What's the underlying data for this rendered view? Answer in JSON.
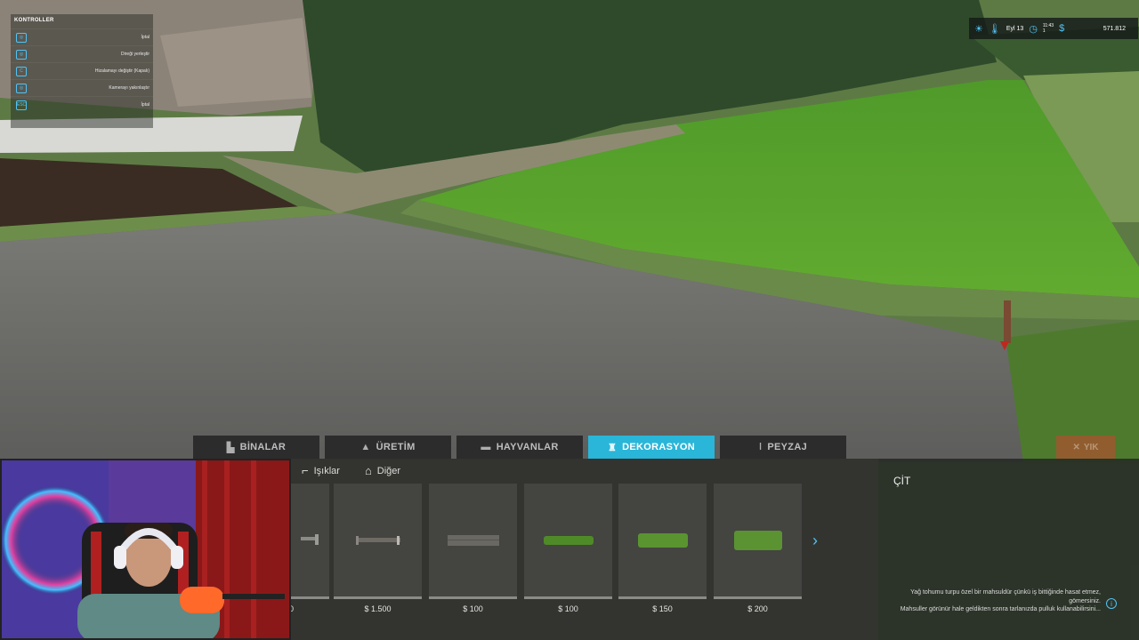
{
  "controls": {
    "title": "KONTROLLER",
    "rows": [
      {
        "key": "",
        "key_icon": "mouse-icon",
        "label": "İptal"
      },
      {
        "key": "",
        "key_icon": "mouse-icon",
        "label": "Direği yerleştir"
      },
      {
        "key": "C",
        "key_icon": "",
        "label": "Hizalamayı değiştir (Kapalı)"
      },
      {
        "key": "",
        "key_icon": "mouse-icon",
        "label": "Kamerayı yakınlaştır"
      },
      {
        "key": "ESC",
        "key_icon": "",
        "label": "İptal"
      }
    ]
  },
  "hud": {
    "weather_icon": "sun-icon",
    "date": "Eyl 13",
    "time": "11:43",
    "time_speed": "1",
    "money": "571.812"
  },
  "tabs": [
    {
      "label": "BİNALAR",
      "icon": "building-icon",
      "active": false
    },
    {
      "label": "ÜRETİM",
      "icon": "production-icon",
      "active": false
    },
    {
      "label": "HAYVANLAR",
      "icon": "cow-icon",
      "active": false
    },
    {
      "label": "DEKORASYON",
      "icon": "decoration-icon",
      "active": true
    },
    {
      "label": "PEYZAJ",
      "icon": "shovel-icon",
      "active": false
    }
  ],
  "exit_button": {
    "label": "YIK"
  },
  "subtabs": [
    {
      "label": "Işıklar",
      "icon": "lamp-icon"
    },
    {
      "label": "Diğer",
      "icon": "house-icon"
    }
  ],
  "items": [
    {
      "price": "0",
      "thumb": "fence-post"
    },
    {
      "price": "$ 1.500",
      "thumb": "fence-wood"
    },
    {
      "price": "$ 100",
      "thumb": "fence-panel"
    },
    {
      "price": "$ 100",
      "thumb": "hedge-low"
    },
    {
      "price": "$ 150",
      "thumb": "hedge-mid"
    },
    {
      "price": "$ 200",
      "thumb": "hedge-tall"
    }
  ],
  "detail": {
    "title": "ÇİT",
    "description_line1": "Yağ tohumu turpu özel bir mahsuldür çünkü iş bittiğinde hasat etmez, gömersiniz.",
    "description_line2": "Mahsuller görünür hale geldikten sonra tarlanızda pulluk kullanabilirsini..."
  },
  "colors": {
    "accent": "#29b6d8",
    "field_green": "#5ea62e",
    "road_gray": "#6e6e6c"
  }
}
